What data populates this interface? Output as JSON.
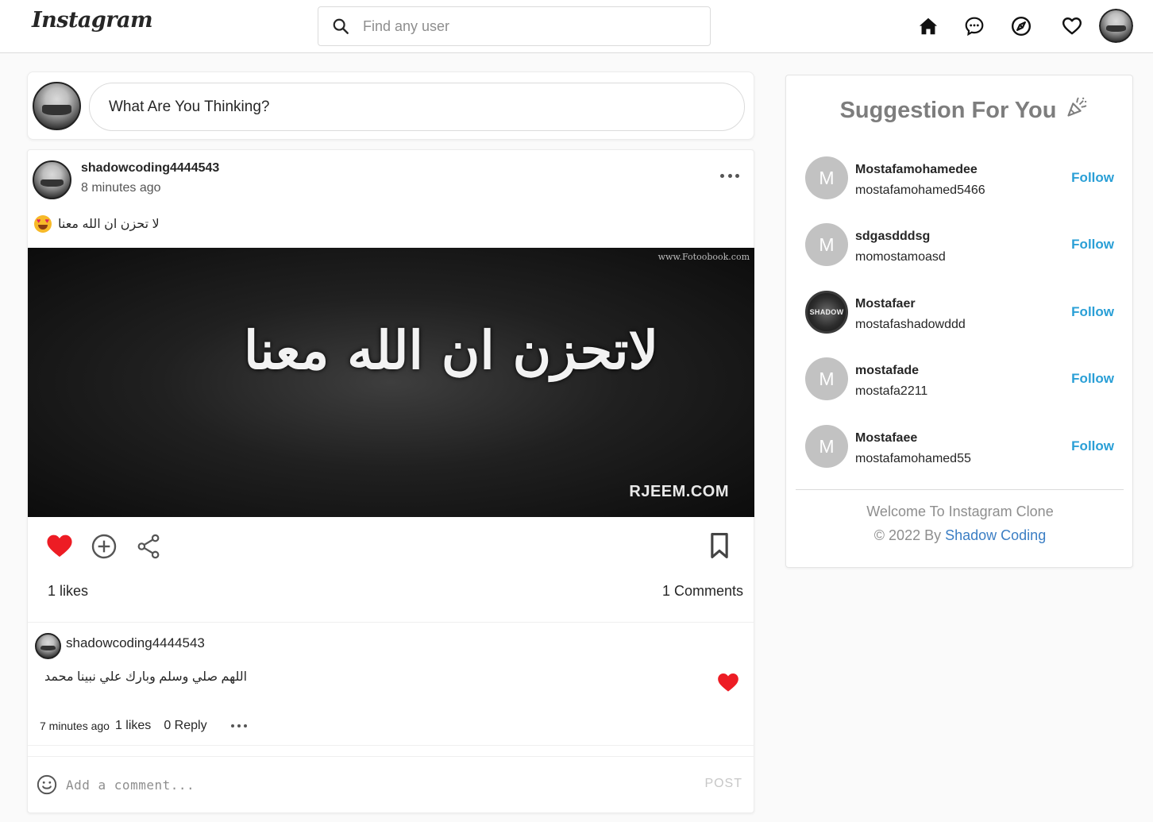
{
  "header": {
    "logo": "Instagram",
    "search_placeholder": "Find any user",
    "nav_icons": [
      "home-icon",
      "messenger-icon",
      "explore-icon",
      "heart-icon",
      "profile-avatar"
    ]
  },
  "composer": {
    "placeholder": "What Are You Thinking?"
  },
  "post": {
    "username": "shadowcoding4444543",
    "time": "8 minutes ago",
    "caption": "لا تحزن ان الله معنا",
    "image": {
      "calligraphy": "لاتحزن ان الله معنا",
      "watermark_top": "www.Fotoobook.com",
      "watermark_bottom": "RJEEM.COM"
    },
    "likes": "1 likes",
    "comments": "1 Comments",
    "comment": {
      "username": "shadowcoding4444543",
      "text": "اللهم صلي وسلم وبارك علي نبينا محمد",
      "time": "7 minutes ago",
      "likes": "1 likes",
      "reply": "0 Reply"
    },
    "add_comment_placeholder": "Add a comment...",
    "post_button": "POST"
  },
  "suggestions": {
    "title": "Suggestion For You",
    "follow_label": "Follow",
    "items": [
      {
        "initial": "M",
        "name": "Mostafamohamedee",
        "handle": "mostafamohamed5466"
      },
      {
        "initial": "M",
        "name": "sdgasdddsg",
        "handle": "momostamoasd"
      },
      {
        "initial": "SHADOW",
        "name": "Mostafaer",
        "handle": "mostafashadowddd"
      },
      {
        "initial": "M",
        "name": "mostafade",
        "handle": "mostafa2211"
      },
      {
        "initial": "M",
        "name": "Mostafaee",
        "handle": "mostafamohamed55"
      }
    ],
    "footer_line1": "Welcome To Instagram Clone",
    "footer_prefix": "© 2022 By ",
    "footer_link": "Shadow Coding"
  },
  "colors": {
    "like_red": "#ed1c24",
    "follow_blue": "#2a9fd6",
    "link_blue": "#3b7ec4"
  }
}
